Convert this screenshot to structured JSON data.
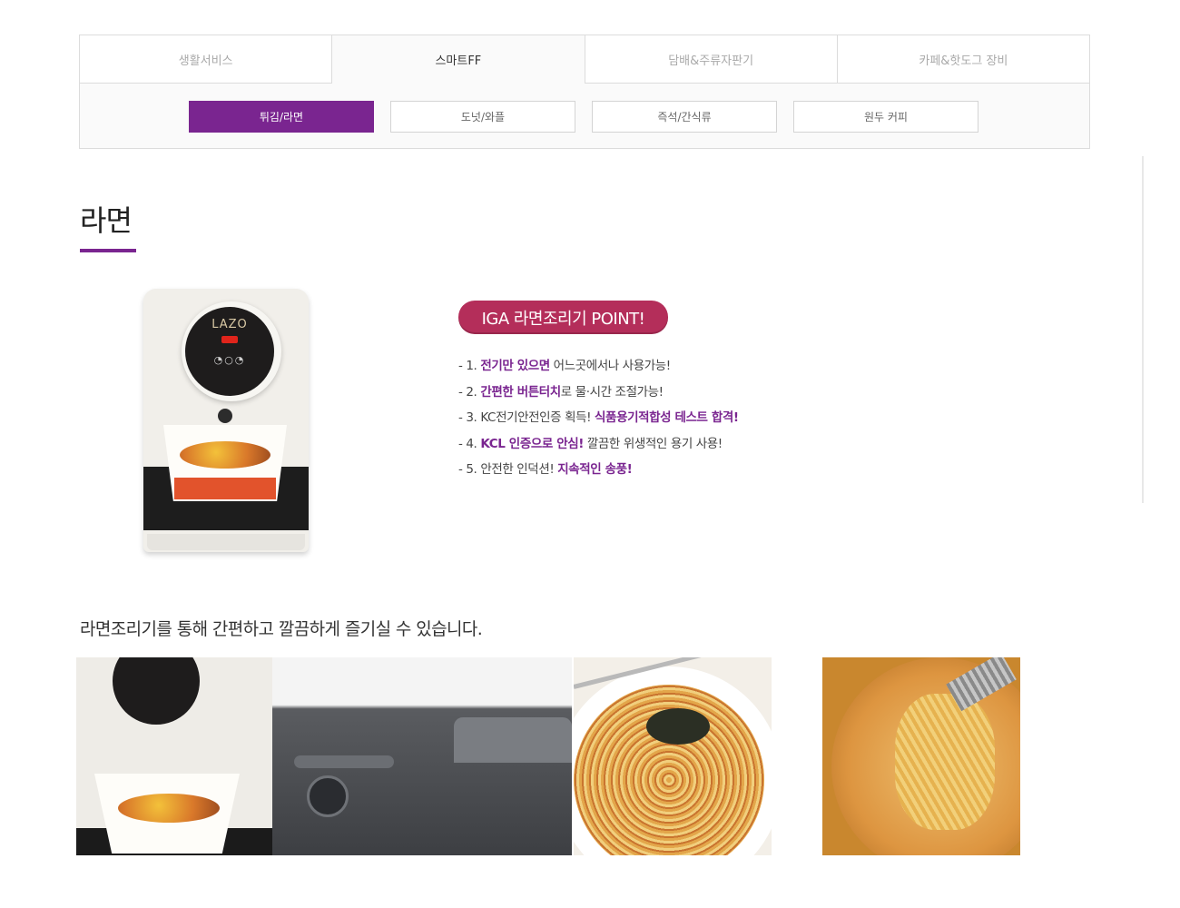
{
  "tabs": {
    "main": [
      {
        "label": "생활서비스",
        "active": false
      },
      {
        "label": "스마트FF",
        "active": true
      },
      {
        "label": "담배&주류자판기",
        "active": false
      },
      {
        "label": "카페&핫도그 장비",
        "active": false
      }
    ],
    "sub": [
      {
        "label": "튀김/라면",
        "active": true
      },
      {
        "label": "도넛/와플",
        "active": false
      },
      {
        "label": "즉석/간식류",
        "active": false
      },
      {
        "label": "원두 커피",
        "active": false
      }
    ]
  },
  "page": {
    "title": "라면",
    "accent_color": "#7a2590"
  },
  "product": {
    "brand_on_device": "LAZO",
    "point_badge": "IGA 라면조리기 POINT!",
    "badge_color": "#b42e5a",
    "points": [
      {
        "prefix": "- 1. ",
        "highlight": "전기만 있으면",
        "suffix": " 어느곳에서나 사용가능!"
      },
      {
        "prefix": "- 2. ",
        "highlight": "간편한 버튼터치",
        "suffix": "로 물·시간 조절가능!"
      },
      {
        "prefix": "- 3. KC전기안전인증 획득! ",
        "highlight": "식품용기적합성 테스트 합격!",
        "suffix": ""
      },
      {
        "prefix": "- 4. ",
        "highlight": "KCL 인증으로 안심!",
        "suffix": " 깔끔한 위생적인 용기 사용!"
      },
      {
        "prefix": "- 5. 안전한 인덕션! ",
        "highlight": "지속적인 송풍!",
        "suffix": ""
      }
    ]
  },
  "caption": "라면조리기를 통해 간편하고 깔끔하게 즐기실 수 있습니다."
}
